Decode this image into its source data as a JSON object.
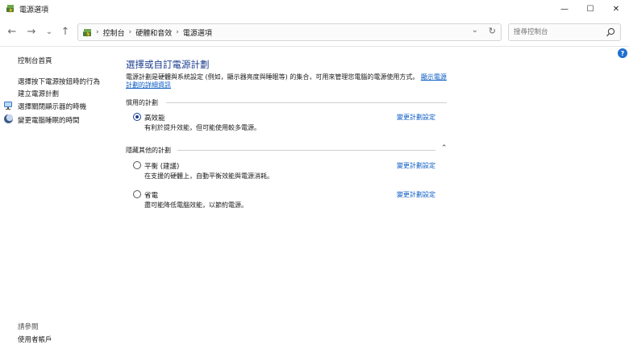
{
  "window": {
    "title": "電源選項",
    "minimize_glyph": "—",
    "maximize_glyph": "☐",
    "close_glyph": "✕"
  },
  "nav": {
    "back_glyph": "←",
    "forward_glyph": "→",
    "recent_glyph": "⌄",
    "up_glyph": "↑",
    "breadcrumbs": [
      "控制台",
      "硬體和音效",
      "電源選項"
    ],
    "breadcrumb_sep": "›",
    "dropdown_glyph": "⌄",
    "refresh_glyph": "↻",
    "search_placeholder": "搜尋控制台"
  },
  "sidebar": {
    "home": "控制台首頁",
    "links": [
      "選擇按下電源按鈕時的行為",
      "建立電源計劃",
      "選擇關閉顯示器的時機",
      "變更電腦睡眠的時間"
    ],
    "see_also_title": "請參閱",
    "see_also_links": [
      "使用者帳戶"
    ]
  },
  "help_glyph": "?",
  "main": {
    "heading": "選擇或自訂電源計劃",
    "description": "電源計劃是硬體與系統設定 (例如，顯示器亮度與睡眠等) 的集合，可用來管理您電腦的電源使用方式。",
    "description_link": "顯示電源計劃的詳細資訊",
    "preferred_group": "慣用的計劃",
    "hidden_group": "隱藏其他的計劃",
    "collapse_glyph": "⌃",
    "change_label": "變更計劃設定",
    "plans": [
      {
        "name": "高效能",
        "desc": "有利於提升效能，但可能使用較多電源。",
        "selected": true
      },
      {
        "name": "平衡 (建議)",
        "desc": "在支援的硬體上，自動平衡效能與電源消耗。",
        "selected": false
      },
      {
        "name": "省電",
        "desc": "盡可能降低電腦效能，以節約電源。",
        "selected": false
      }
    ]
  },
  "colors": {
    "heading": "#1b3d8f",
    "link": "#0a5bc4",
    "help_badge": "#1f6fd0"
  }
}
